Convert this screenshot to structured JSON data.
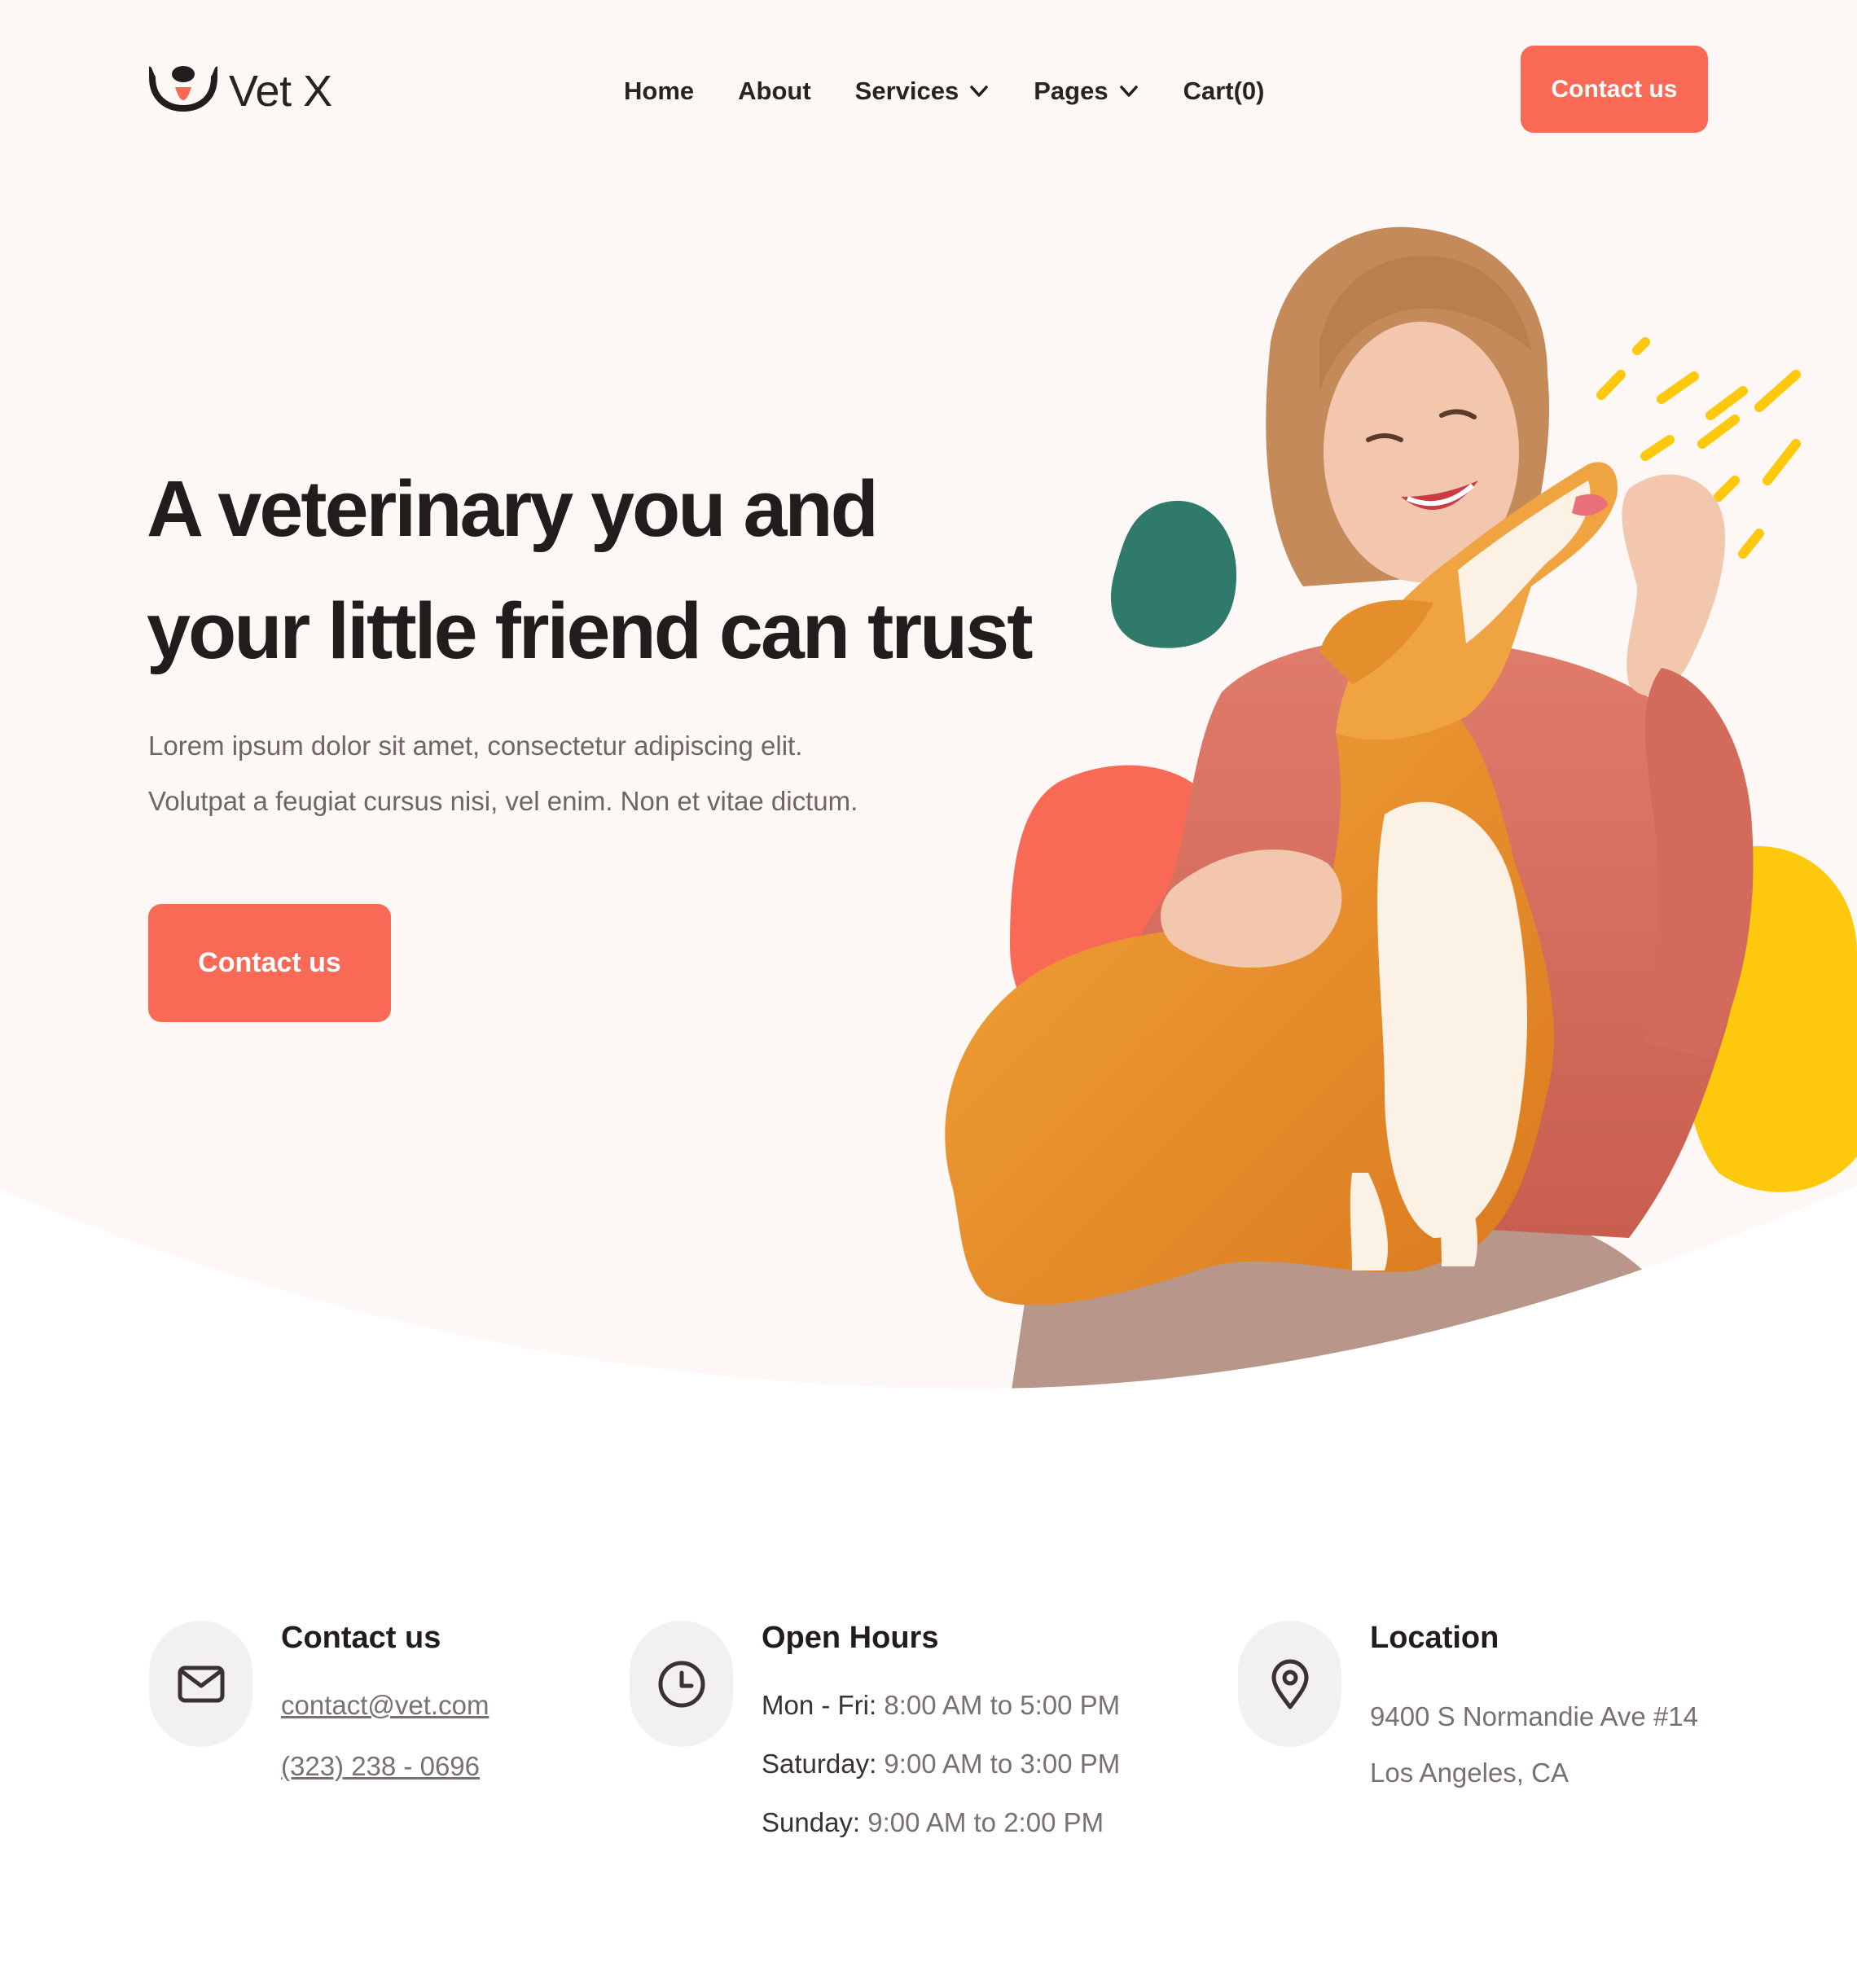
{
  "brand": {
    "name": "Vet X"
  },
  "nav": {
    "home": "Home",
    "about": "About",
    "services": "Services",
    "pages": "Pages",
    "cart": "Cart(0)"
  },
  "header": {
    "cta": "Contact us"
  },
  "hero": {
    "title_line1": "A veterinary you and",
    "title_line2": "your little friend can trust",
    "desc_line1": "Lorem ipsum dolor sit amet, consectetur adipiscing elit.",
    "desc_line2": "Volutpat a feugiat cursus nisi, vel enim. Non et vitae dictum.",
    "cta": "Contact us"
  },
  "contact": {
    "title": "Contact us",
    "email": "contact@vet.com",
    "phone": "(323) 238 - 0696"
  },
  "hours": {
    "title": "Open Hours",
    "rows": [
      {
        "day": "Mon - Fri:",
        "time": "8:00 AM to 5:00 PM"
      },
      {
        "day": "Saturday:",
        "time": "9:00 AM to 3:00 PM"
      },
      {
        "day": "Sunday:",
        "time": "9:00 AM to 2:00 PM"
      }
    ]
  },
  "location": {
    "title": "Location",
    "line1": "9400 S Normandie Ave #14",
    "line2": "Los Angeles, CA"
  },
  "icons": {
    "logo": "dog-face-icon",
    "nav_dropdown": "chevron-down-icon",
    "contact": "mail-icon",
    "hours": "clock-icon",
    "location": "map-pin-icon"
  },
  "colors": {
    "accent": "#f86a55",
    "hero_bg": "#fdf8f5",
    "teal": "#2f7a6a",
    "yellow": "#fec80c",
    "text_dark": "#231c1c",
    "text_muted": "#6e6565"
  }
}
